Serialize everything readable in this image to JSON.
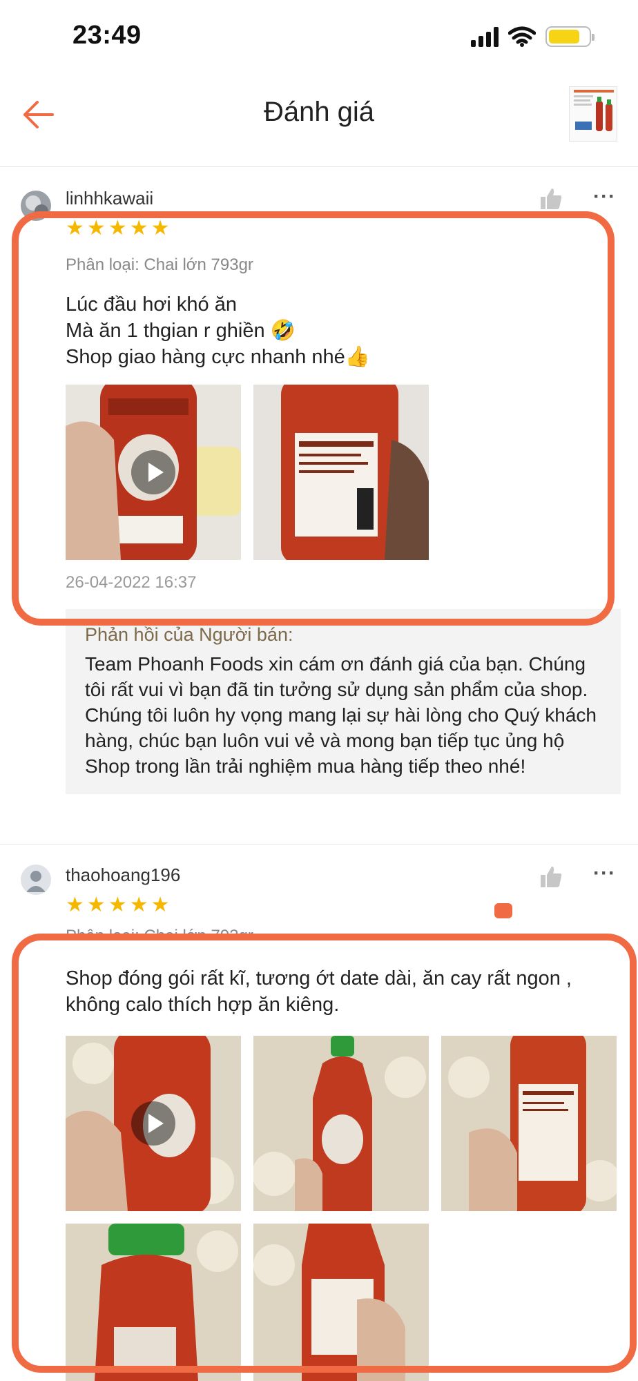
{
  "status_bar": {
    "time": "23:49",
    "battery_level": 0.78
  },
  "nav": {
    "title": "Đánh giá"
  },
  "colors": {
    "accent": "#f06a43",
    "star": "#f5b800"
  },
  "reviews": [
    {
      "username": "linhhkawaii",
      "rating": 5,
      "variation": "Phân loại: Chai lớn 793gr",
      "comment_lines": [
        "Lúc đầu hơi khó ăn",
        "Mà ăn 1 thgian r ghiền 🤣",
        "Shop giao hàng cực nhanh nhé👍"
      ],
      "timestamp": "26-04-2022 16:37",
      "seller_reply": {
        "title": "Phản hồi của Người bán:",
        "text": "Team Phoanh Foods xin cám ơn đánh giá của bạn. Chúng tôi rất vui vì bạn đã tin tưởng sử dụng sản phẩm của shop. Chúng tôi luôn hy vọng mang lại sự hài lòng cho Quý khách hàng, chúc bạn luôn vui vẻ và mong bạn tiếp tục ủng hộ Shop trong lần trải nghiệm mua hàng tiếp theo nhé!"
      }
    },
    {
      "username": "thaohoang196",
      "rating": 5,
      "variation": "Phân loại: Chai lớn 793gr",
      "comment_lines": [
        "Shop đóng gói rất kĩ, tương ớt date dài, ăn cay rất ngon ,",
        "không calo thích hợp ăn kiêng."
      ]
    }
  ]
}
